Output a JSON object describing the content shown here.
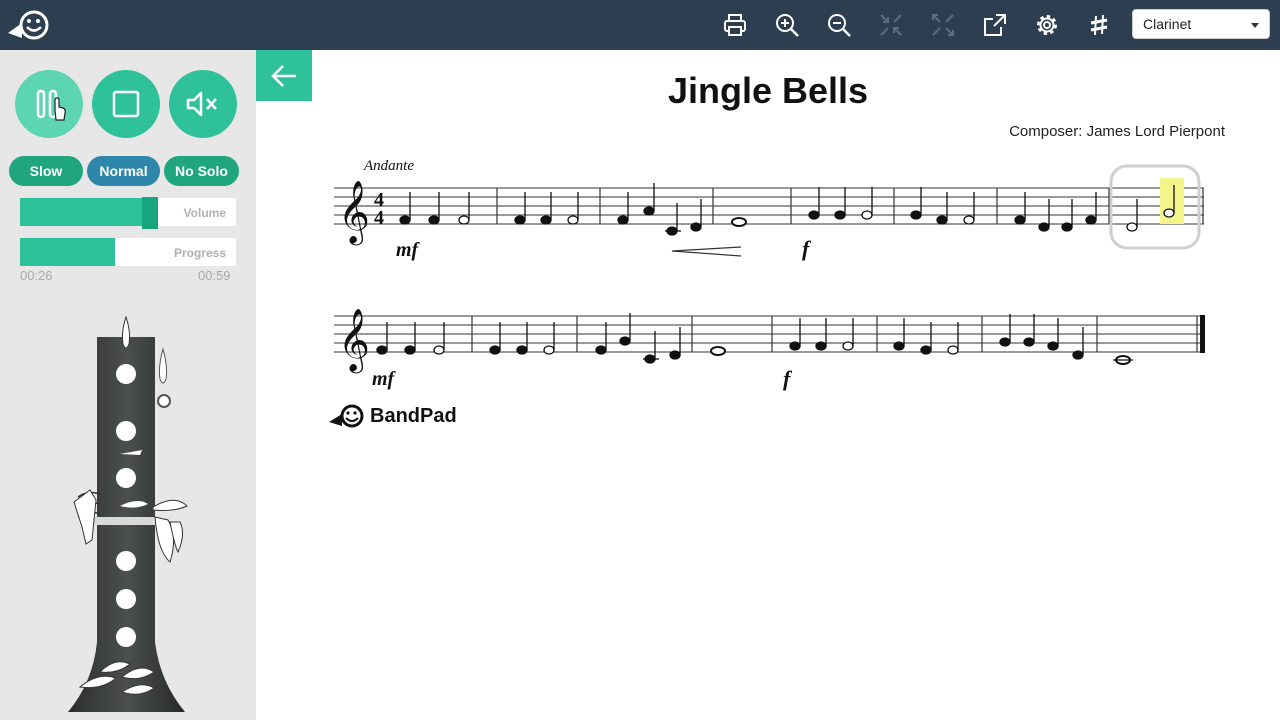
{
  "toolbar": {
    "icons": [
      "print-icon",
      "zoom-in-icon",
      "zoom-out-icon",
      "collapse-icon",
      "expand-icon",
      "open-external-icon",
      "settings-icon",
      "sharp-icon"
    ],
    "instrument": "Clarinet"
  },
  "controls": {
    "pause_icon": "pause-icon",
    "stop_icon": "stop-icon",
    "mute_icon": "mute-icon",
    "speed_slow": "Slow",
    "speed_normal": "Normal",
    "solo": "No Solo",
    "volume_label": "Volume",
    "volume_level": 0.6,
    "progress_label": "Progress",
    "progress_level": 0.44,
    "time_current": "00:26",
    "time_total": "00:59"
  },
  "score": {
    "title": "Jingle Bells",
    "composer": "Composer: James Lord Pierpont",
    "tempo": "Andante",
    "time_signature": "4/4",
    "dynamics": [
      "mf",
      "f",
      "mf",
      "f"
    ]
  },
  "brand": {
    "name": "BandPad"
  },
  "colors": {
    "topbar": "#2c3e50",
    "accent": "#2fc29a",
    "normal_pill": "#2e86ab",
    "highlight": "#f3f58a"
  }
}
